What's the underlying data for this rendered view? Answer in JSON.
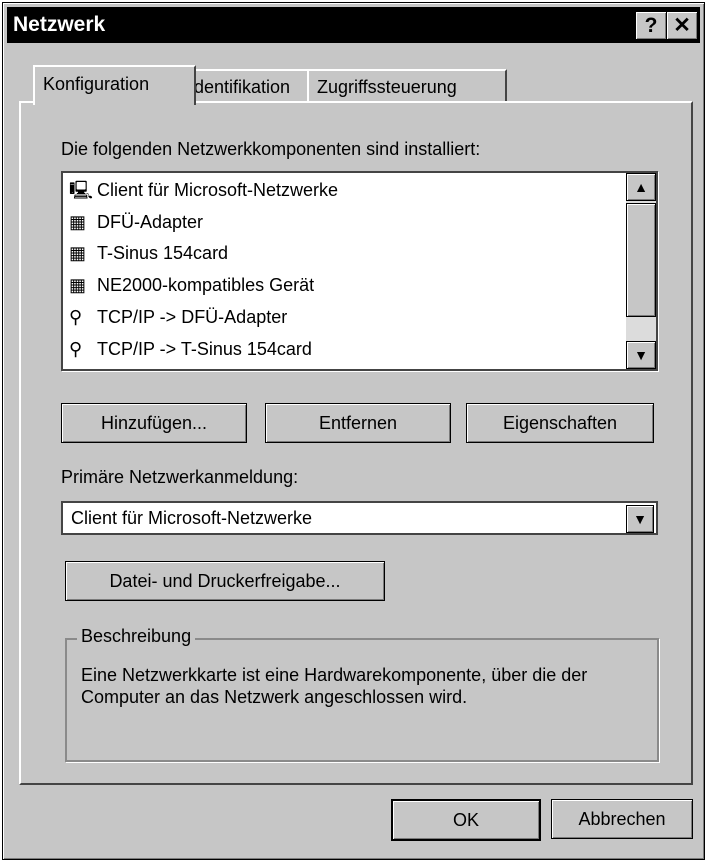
{
  "window": {
    "title": "Netzwerk",
    "help_label": "?",
    "close_label": "✕"
  },
  "tabs": [
    {
      "label": "Konfiguration",
      "active": true
    },
    {
      "label": "Identifikation",
      "active": false
    },
    {
      "label": "Zugriffssteuerung",
      "active": false
    }
  ],
  "components": {
    "label": "Die folgenden Netzwerkkomponenten sind installiert:",
    "items": [
      {
        "icon": "client-icon",
        "glyph": "🖳",
        "label": "Client für Microsoft-Netzwerke"
      },
      {
        "icon": "adapter-icon",
        "glyph": "▦",
        "label": "DFÜ-Adapter"
      },
      {
        "icon": "adapter-icon",
        "glyph": "▦",
        "label": "T-Sinus 154card"
      },
      {
        "icon": "adapter-icon",
        "glyph": "▦",
        "label": "NE2000-kompatibles Gerät"
      },
      {
        "icon": "protocol-icon",
        "glyph": "⚲",
        "label": "TCP/IP -> DFÜ-Adapter"
      },
      {
        "icon": "protocol-icon",
        "glyph": "⚲",
        "label": "TCP/IP -> T-Sinus 154card"
      }
    ],
    "scroll_up": "▲",
    "scroll_down": "▼"
  },
  "buttons": {
    "add": "Hinzufügen...",
    "remove": "Entfernen",
    "properties": "Eigenschaften",
    "file_print_sharing": "Datei- und Druckerfreigabe...",
    "ok": "OK",
    "cancel": "Abbrechen"
  },
  "primary_logon": {
    "label": "Primäre Netzwerkanmeldung:",
    "value": "Client für Microsoft-Netzwerke",
    "arrow": "▼"
  },
  "description": {
    "legend": "Beschreibung",
    "text": "Eine Netzwerkkarte ist eine Hardwarekomponente, über die der Computer an das Netzwerk angeschlossen wird."
  }
}
